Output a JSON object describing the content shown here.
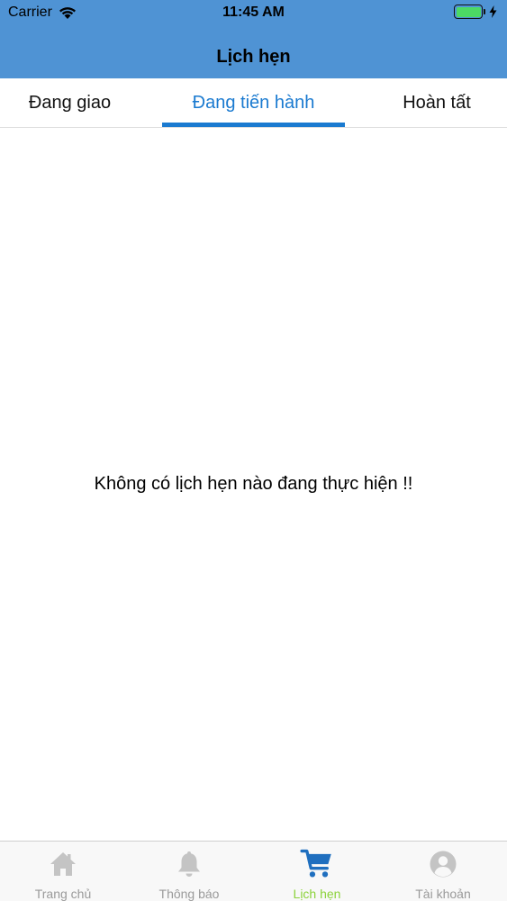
{
  "status_bar": {
    "carrier": "Carrier",
    "time": "11:45 AM"
  },
  "header": {
    "title": "Lịch hẹn"
  },
  "tabs": [
    {
      "label": "Đang giao"
    },
    {
      "label": "Đang tiến hành"
    },
    {
      "label": "Hoàn tất"
    }
  ],
  "empty_message": "Không có lịch hẹn nào đang thực hiện !!",
  "tabbar": {
    "items": [
      {
        "label": "Trang chủ",
        "icon": "home-icon"
      },
      {
        "label": "Thông báo",
        "icon": "bell-icon"
      },
      {
        "label": "Lịch hẹn",
        "icon": "cart-icon"
      },
      {
        "label": "Tài khoản",
        "icon": "account-icon"
      }
    ]
  },
  "colors": {
    "header_bg": "#4f93d4",
    "active_tab": "#1a7ad0",
    "active_tabbar_label": "#8bd23a",
    "inactive_gray": "#9a9a9a",
    "battery": "#4cd964"
  }
}
